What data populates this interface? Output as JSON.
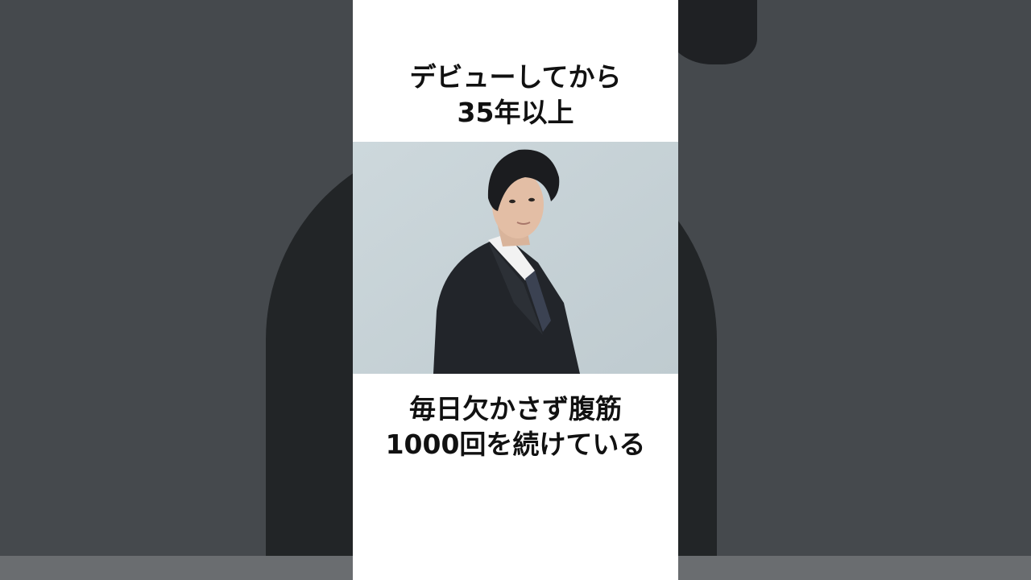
{
  "caption_top": {
    "line1": "デビューしてから",
    "line2": "35年以上"
  },
  "caption_bottom": {
    "line1": "毎日欠かさず腹筋",
    "line2": "1000回を続けている"
  },
  "colors": {
    "background": "#3a3d41",
    "card": "#ffffff",
    "text": "#111111",
    "photo_backdrop": "#c7d3d8"
  }
}
